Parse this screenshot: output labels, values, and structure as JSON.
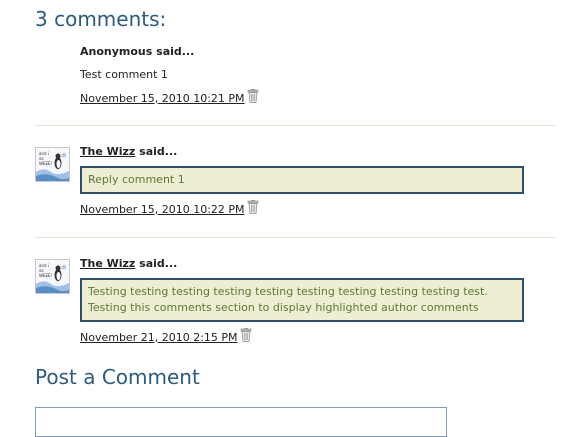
{
  "comments_section": {
    "heading": "3 comments:"
  },
  "comments": [
    {
      "author": "Anonymous",
      "said": " said...",
      "body": "Test comment 1",
      "timestamp": "November 15, 2010 10:21 PM"
    },
    {
      "author": "The Wizz",
      "said": " said...",
      "body": "Reply comment 1",
      "timestamp": "November 15, 2010 10:22 PM"
    },
    {
      "author": "The Wizz",
      "said": " said...",
      "body": "Testing testing testing testing testing testing testing testing testing test. Testing this comments section to display highlighted author comments",
      "timestamp": "November 21, 2010 2:15 PM"
    }
  ],
  "post_comment": {
    "heading": "Post a Comment"
  },
  "icons": {
    "delete": "trash-icon",
    "avatar": "avatar-image"
  },
  "colors": {
    "heading": "#2c5a80",
    "highlight_bg": "#eeeed5",
    "highlight_border": "#2f4f6d",
    "highlight_text": "#5a7a32"
  }
}
